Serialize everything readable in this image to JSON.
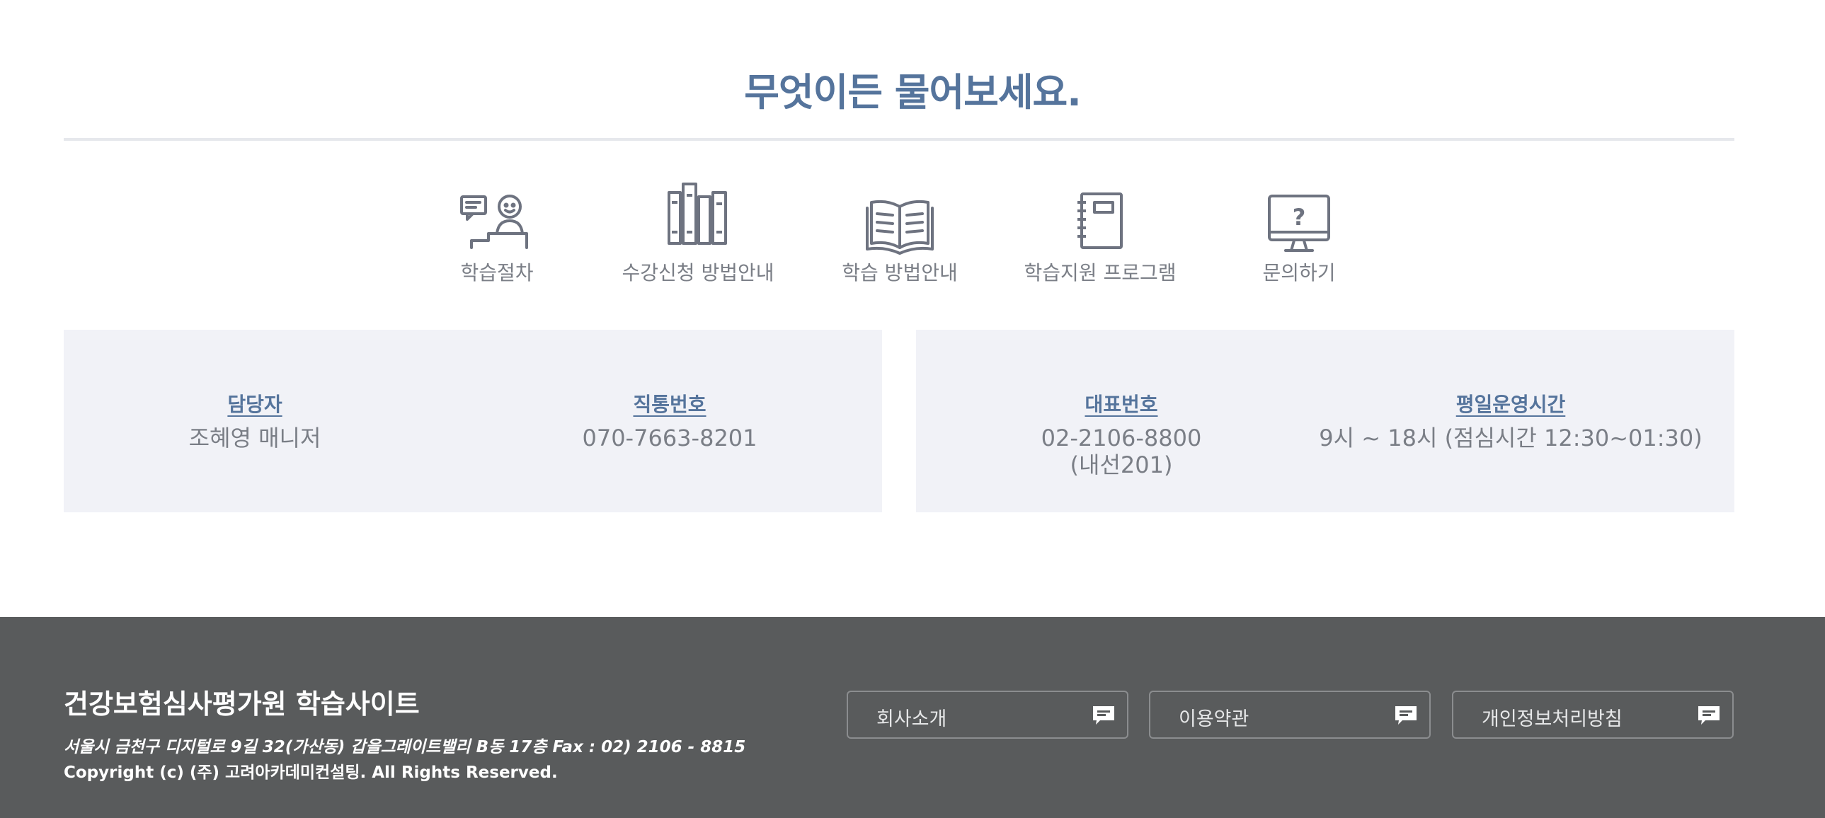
{
  "page_title": "무엇이든 물어보세요.",
  "quick_menu": [
    {
      "label": "학습절차",
      "icon": "teacher-icon"
    },
    {
      "label": "수강신청 방법안내",
      "icon": "books-icon"
    },
    {
      "label": "학습 방법안내",
      "icon": "open-book-icon"
    },
    {
      "label": "학습지원 프로그램",
      "icon": "notebook-icon"
    },
    {
      "label": "문의하기",
      "icon": "monitor-question-icon"
    }
  ],
  "contact_left": {
    "manager_label": "담당자",
    "manager_value": "조혜영 매니저",
    "direct_label": "직통번호",
    "direct_value": "070-7663-8201"
  },
  "contact_right": {
    "main_label": "대표번호",
    "main_value_line1": "02-2106-8800",
    "main_value_line2": "(내선201)",
    "hours_label": "평일운영시간",
    "hours_value": "9시 ~ 18시 (점심시간 12:30~01:30)"
  },
  "footer": {
    "site_title": "건강보험심사평가원 학습사이트",
    "address": "서울시 금천구 디지털로 9길 32(가산동) 갑을그레이트밸리 B동 17층   Fax : 02) 2106 - 8815",
    "copyright": "Copyright (c) (주) 고려아카데미컨설팅. All Rights Reserved.",
    "buttons": [
      {
        "label": "회사소개",
        "icon": "chat-bubble-icon"
      },
      {
        "label": "이용약관",
        "icon": "chat-bubble-icon"
      },
      {
        "label": "개인정보처리방침",
        "icon": "chat-bubble-icon"
      }
    ]
  },
  "colors": {
    "accent": "#55749c",
    "icon_gray": "#6e7380",
    "text_gray": "#7a7e86",
    "panel_bg": "#f1f2f7",
    "footer_bg": "#595b5c"
  }
}
